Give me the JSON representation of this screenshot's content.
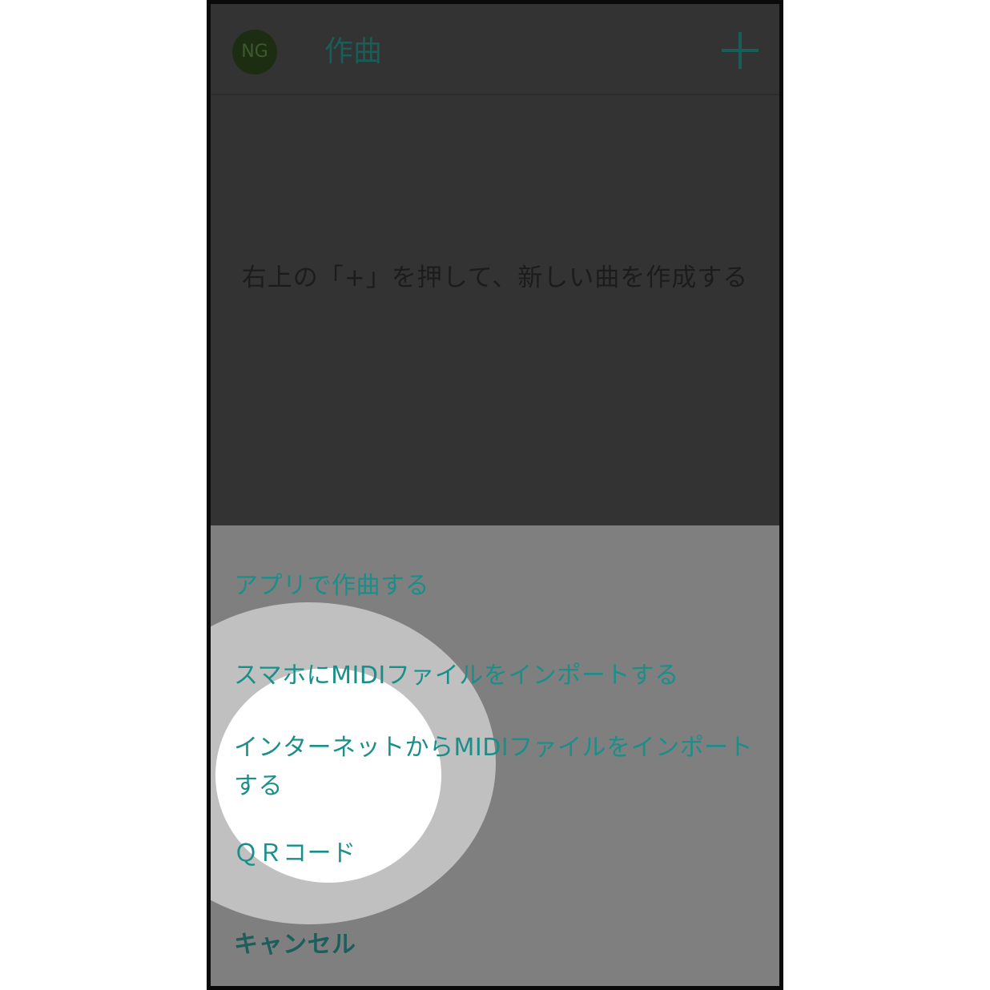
{
  "header": {
    "avatar_initials": "NG",
    "title": "作曲",
    "add_icon": "plus-icon"
  },
  "main": {
    "empty_message": "右上の「+」を押して、新しい曲を作成する"
  },
  "sheet": {
    "items": [
      {
        "label": "アプリで作曲する"
      },
      {
        "label": "スマホにMIDIファイルをインポートする"
      },
      {
        "label": "インターネットからMIDIファイルをインポートする"
      },
      {
        "label": "ＱＲコード"
      },
      {
        "label": "キャンセル"
      }
    ]
  },
  "colors": {
    "accent": "#1a8f8a",
    "overlay": "#333333",
    "sheet_background": "#7f7f7f"
  }
}
